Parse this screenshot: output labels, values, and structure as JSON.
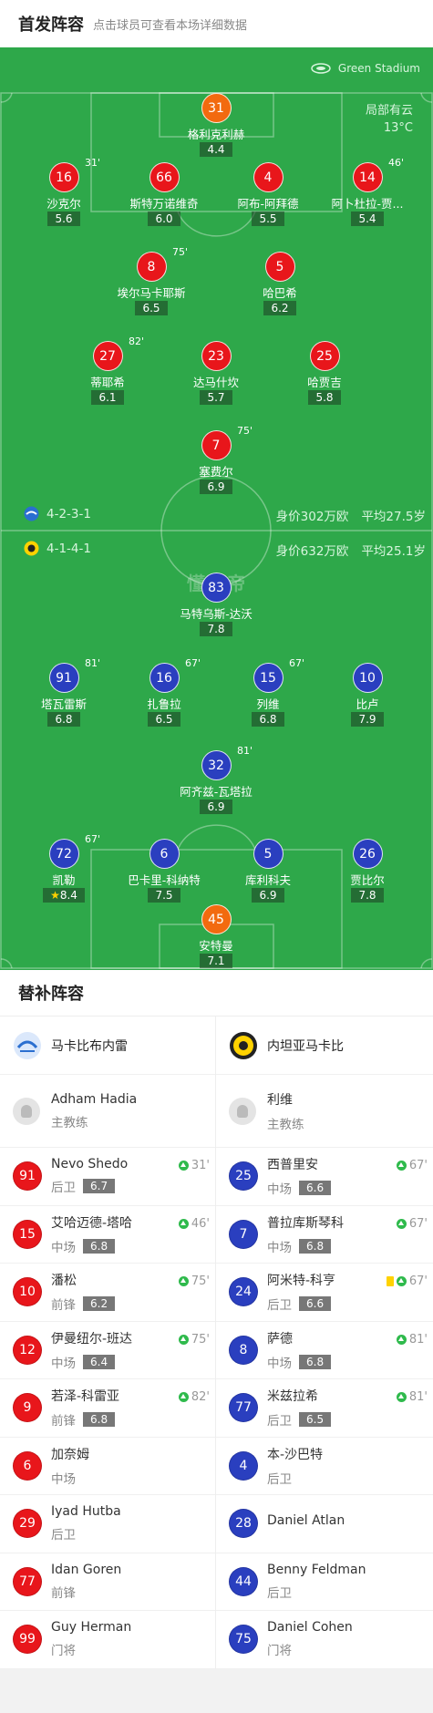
{
  "header": {
    "title": "首发阵容",
    "subtitle": "点击球员可查看本场详细数据"
  },
  "pitch": {
    "stadium": "Green Stadium",
    "weather_line1": "局部有云",
    "weather_line2": "13°C",
    "watermark": "懂球帝",
    "home_formation": {
      "formation": "4-2-3-1",
      "value": "身价302万欧",
      "avg_age": "平均27.5岁"
    },
    "away_formation": {
      "formation": "4-1-4-1",
      "value": "身价632万欧",
      "avg_age": "平均25.1岁"
    }
  },
  "home_players": [
    {
      "number": "31",
      "name": "格利克利赫",
      "rating": "4.4",
      "gk": true
    },
    {
      "number": "16",
      "name": "沙克尔",
      "rating": "5.6",
      "sub": "31'"
    },
    {
      "number": "66",
      "name": "斯特万诺维奇",
      "rating": "6.0",
      "card": "red"
    },
    {
      "number": "4",
      "name": "阿布-阿拜德",
      "rating": "5.5",
      "card": "yellow"
    },
    {
      "number": "14",
      "name": "阿卜杜拉-贾...",
      "rating": "5.4",
      "sub": "46'",
      "captain": true
    },
    {
      "number": "8",
      "name": "埃尔马卡耶斯",
      "rating": "6.5",
      "sub": "75'"
    },
    {
      "number": "5",
      "name": "哈巴希",
      "rating": "6.2"
    },
    {
      "number": "27",
      "name": "蒂耶希",
      "rating": "6.1",
      "sub": "82'",
      "card": "yellow"
    },
    {
      "number": "23",
      "name": "达马什坎",
      "rating": "5.7"
    },
    {
      "number": "25",
      "name": "哈贾吉",
      "rating": "5.8"
    },
    {
      "number": "7",
      "name": "塞费尔",
      "rating": "6.9",
      "sub": "75'"
    }
  ],
  "away_players": [
    {
      "number": "83",
      "name": "马特乌斯-达沃",
      "rating": "7.8",
      "goal": true
    },
    {
      "number": "91",
      "name": "塔瓦雷斯",
      "rating": "6.8",
      "sub": "81'",
      "assist": true
    },
    {
      "number": "16",
      "name": "扎鲁拉",
      "rating": "6.5",
      "sub": "67'"
    },
    {
      "number": "15",
      "name": "列维",
      "rating": "6.8",
      "sub": "67'"
    },
    {
      "number": "10",
      "name": "比卢",
      "rating": "7.9",
      "goal": true
    },
    {
      "number": "32",
      "name": "阿齐兹-瓦塔拉",
      "rating": "6.9",
      "sub": "81'"
    },
    {
      "number": "72",
      "name": "凯勒",
      "rating": "8.4",
      "sub": "67'",
      "goal": true,
      "assist": true,
      "star": true
    },
    {
      "number": "6",
      "name": "巴卡里-科纳特",
      "rating": "7.5",
      "goal": true
    },
    {
      "number": "5",
      "name": "库利科夫",
      "rating": "6.9"
    },
    {
      "number": "26",
      "name": "贾比尔",
      "rating": "7.8",
      "captain": true
    },
    {
      "number": "45",
      "name": "安特曼",
      "rating": "7.1",
      "gk": true
    }
  ],
  "subs": {
    "title": "替补阵容",
    "home": {
      "team": "马卡比布内雷",
      "coach": {
        "name": "Adham Hadia",
        "role": "主教练"
      },
      "players": [
        {
          "number": "91",
          "name": "Nevo Shedo",
          "pos": "后卫",
          "rating": "6.7",
          "in": "31'"
        },
        {
          "number": "15",
          "name": "艾哈迈德-塔哈",
          "pos": "中场",
          "rating": "6.8",
          "in": "46'"
        },
        {
          "number": "10",
          "name": "潘松",
          "pos": "前锋",
          "rating": "6.2",
          "in": "75'"
        },
        {
          "number": "12",
          "name": "伊曼纽尔-班达",
          "pos": "中场",
          "rating": "6.4",
          "in": "75'"
        },
        {
          "number": "9",
          "name": "若泽-科雷亚",
          "pos": "前锋",
          "rating": "6.8",
          "in": "82'"
        },
        {
          "number": "6",
          "name": "加奈姆",
          "pos": "中场"
        },
        {
          "number": "29",
          "name": "Iyad Hutba",
          "pos": "后卫"
        },
        {
          "number": "77",
          "name": "Idan Goren",
          "pos": "前锋"
        },
        {
          "number": "99",
          "name": "Guy Herman",
          "pos": "门将"
        }
      ]
    },
    "away": {
      "team": "内坦亚马卡比",
      "coach": {
        "name": "利维",
        "role": "主教练"
      },
      "players": [
        {
          "number": "25",
          "name": "西普里安",
          "pos": "中场",
          "rating": "6.6",
          "in": "67'"
        },
        {
          "number": "7",
          "name": "普拉库斯琴科",
          "pos": "中场",
          "rating": "6.8",
          "in": "67'"
        },
        {
          "number": "24",
          "name": "阿米特-科亨",
          "pos": "后卫",
          "rating": "6.6",
          "in": "67'",
          "card": "yellow"
        },
        {
          "number": "8",
          "name": "萨德",
          "pos": "中场",
          "rating": "6.8",
          "in": "81'"
        },
        {
          "number": "77",
          "name": "米兹拉希",
          "pos": "后卫",
          "rating": "6.5",
          "in": "81'"
        },
        {
          "number": "4",
          "name": "本-沙巴特",
          "pos": "后卫"
        },
        {
          "number": "28",
          "name": "Daniel Atlan",
          "pos": ""
        },
        {
          "number": "44",
          "name": "Benny Feldman",
          "pos": "后卫"
        },
        {
          "number": "75",
          "name": "Daniel Cohen",
          "pos": "门将"
        }
      ]
    }
  }
}
